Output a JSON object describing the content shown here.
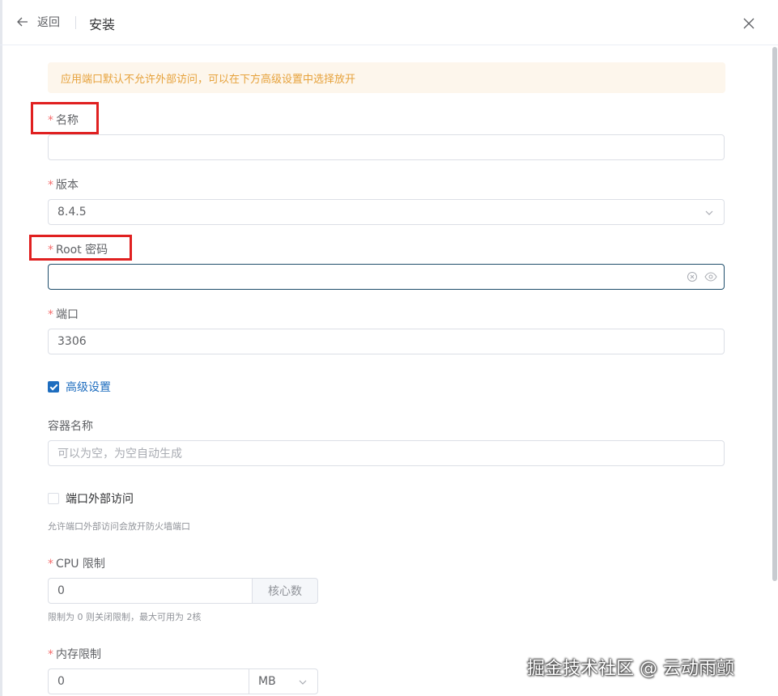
{
  "header": {
    "back_label": "返回",
    "title": "安装"
  },
  "alert": {
    "text": "应用端口默认不允许外部访问，可以在下方高级设置中选择放开"
  },
  "form": {
    "name": {
      "label": "名称",
      "required": "*",
      "value": ""
    },
    "version": {
      "label": "版本",
      "required": "*",
      "value": "8.4.5"
    },
    "root_password": {
      "label": "Root 密码",
      "required": "*",
      "value": ""
    },
    "port": {
      "label": "端口",
      "required": "*",
      "value": "3306"
    },
    "advanced": {
      "label": "高级设置",
      "checked": true
    },
    "container_name": {
      "label": "容器名称",
      "placeholder": "可以为空，为空自动生成",
      "value": ""
    },
    "external_access": {
      "label": "端口外部访问",
      "checked": false,
      "hint": "允许端口外部访问会放开防火墙端口"
    },
    "cpu_limit": {
      "label": "CPU 限制",
      "required": "*",
      "value": "0",
      "unit": "核心数",
      "hint": "限制为 0 则关闭限制，最大可用为 2核"
    },
    "memory_limit": {
      "label": "内存限制",
      "required": "*",
      "value": "0",
      "unit": "MB"
    }
  },
  "watermark": "掘金技术社区 @ 云动雨颤",
  "colors": {
    "accent": "#1e6dbf",
    "required": "#f56c6c",
    "warning_text": "#e6a23c",
    "warning_bg": "#fdf6ec",
    "highlight_box": "#e02020"
  }
}
